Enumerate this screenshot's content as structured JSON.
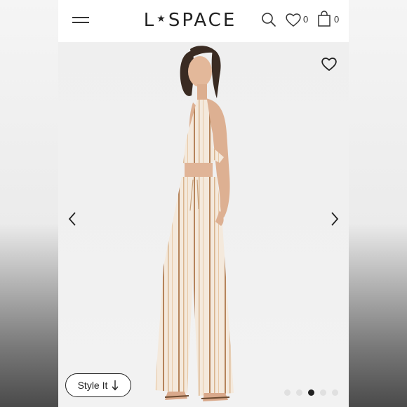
{
  "header": {
    "logo_text": "L★SPACE",
    "logo_left": "L",
    "logo_star": "★",
    "logo_right": "SPACE",
    "menu_icon": "hamburger-icon",
    "search_icon": "search-icon",
    "wishlist_icon": "heart-icon",
    "wishlist_count": "0",
    "bag_icon": "shopping-bag-icon",
    "bag_count": "0"
  },
  "product_gallery": {
    "favorite_icon": "heart-outline-icon",
    "prev_icon": "chevron-left-icon",
    "next_icon": "chevron-right-icon",
    "style_it_label": "Style It",
    "style_it_icon": "arrow-down-icon",
    "image_count": 5,
    "active_index": 3,
    "fabric_colors": {
      "base": "#f4e9dc",
      "stripe": "#b5835a"
    }
  }
}
